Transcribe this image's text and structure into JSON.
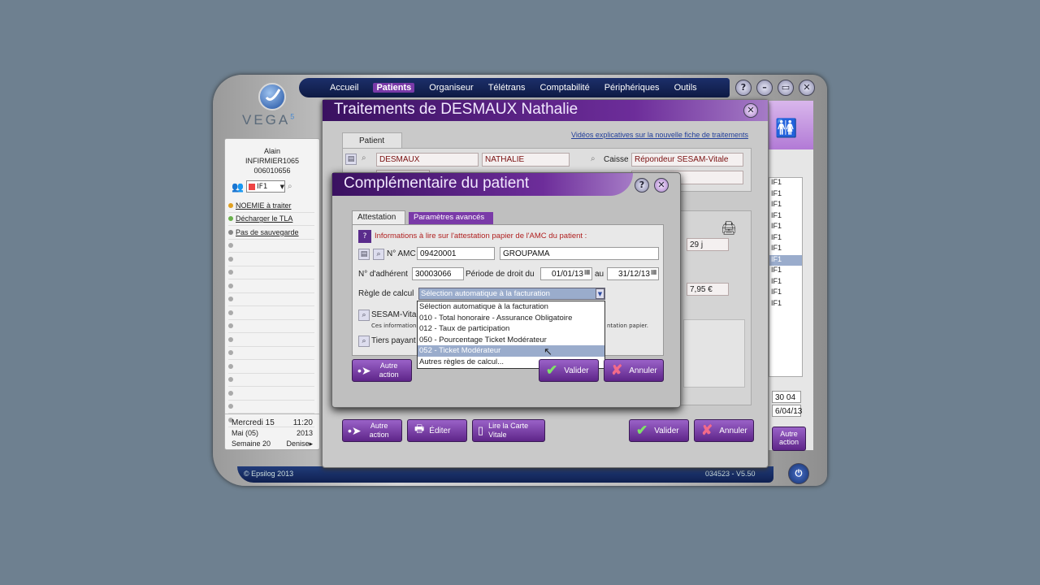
{
  "nav": {
    "items": [
      "Accueil",
      "Patients",
      "Organiseur",
      "Télétrans",
      "Comptabilité",
      "Périphériques",
      "Outils"
    ],
    "active": "Patients"
  },
  "brand": {
    "name": "VEGA",
    "version_mark": "5"
  },
  "user": {
    "name": "Alain",
    "role": "INFIRMIER1065",
    "id": "006010656",
    "profile": "IF1"
  },
  "left_menu": [
    "NOEMIE à traiter",
    "Décharger le TLA",
    "Pas de sauvegarde"
  ],
  "date": {
    "day": "Mercredi 15",
    "time": "11:20",
    "month": "Mai (05)",
    "year": "2013",
    "week": "Semaine 20",
    "user": "Denise"
  },
  "footer": {
    "copyright": "© Epsilog 2013",
    "version": "034523 - V5.50"
  },
  "main": {
    "title": "Traitements de DESMAUX Nathalie",
    "video_link": "Vidéos explicatives sur la nouvelle fiche de traitements",
    "tab": "Patient",
    "last_name": "DESMAUX",
    "first_name": "NATHALIE",
    "caisse_label": "Caisse",
    "caisse_value": "Répondeur SESAM-Vitale",
    "days": "29 j",
    "amount": "7,95 €",
    "buttons": {
      "autre_action": "Autre action",
      "editer": "Éditer",
      "lire_carte": "Lire la Carte Vitale",
      "valider": "Valider",
      "annuler": "Annuler"
    }
  },
  "right_list": {
    "items": [
      "IF1",
      "IF1",
      "IF1",
      "IF1",
      "IF1",
      "IF1",
      "IF1",
      "IF1",
      "IF1",
      "IF1",
      "IF1",
      "IF1"
    ],
    "field1": "30 04",
    "field2": "6/04/13",
    "button": "Autre action"
  },
  "dialog": {
    "title": "Complémentaire du patient",
    "tabs": [
      "Attestation",
      "Paramètres avancés"
    ],
    "info": "Informations à lire sur l'attestation papier de l'AMC du patient :",
    "amc_label": "N° AMC",
    "amc_value": "09420001",
    "amc_name": "GROUPAMA",
    "adherent_label": "N° d'adhérent",
    "adherent_value": "30003066",
    "periode_label": "Période de droit du",
    "periode_from": "01/01/13",
    "periode_au": "au",
    "periode_to": "31/12/13",
    "regle_label": "Règle de calcul",
    "regle_value": "Sélection automatique à la facturation",
    "sesam_label": "SESAM-Vital",
    "ces_info": "Ces informations",
    "attestation_papier": "ntation papier.",
    "tiers_label": "Tiers payant",
    "options": [
      "Sélection automatique à la facturation",
      "010 - Total honoraire - Assurance Obligatoire",
      "012 - Taux de participation",
      "050 - Pourcentage Ticket Modérateur",
      "052 - Ticket Modérateur",
      "Autres règles de calcul..."
    ],
    "highlighted_option": "052 - Ticket Modérateur",
    "buttons": {
      "autre_action": "Autre action",
      "valider": "Valider",
      "annuler": "Annuler"
    }
  },
  "colors": {
    "accent": "#6d2d9a",
    "nav": "#14245a",
    "highlight": "#9aaccc"
  }
}
